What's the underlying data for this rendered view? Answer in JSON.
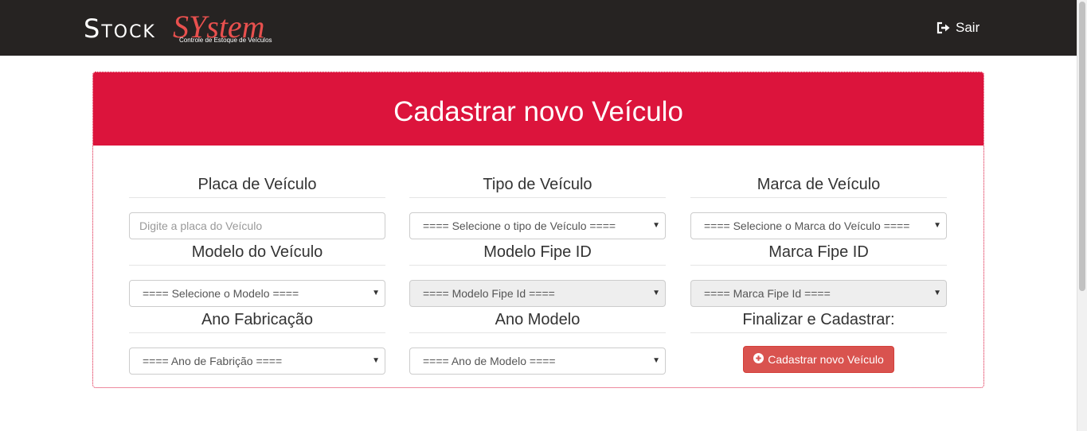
{
  "navbar": {
    "brand_stock": "Stock",
    "brand_system": "SYstem",
    "brand_subtitle": "Controle de Estoque de Veículos",
    "logout_label": "Sair"
  },
  "panel": {
    "title": "Cadastrar novo Veículo"
  },
  "form": {
    "placa": {
      "label": "Placa de Veículo",
      "placeholder": "Digite a placa do Veículo"
    },
    "tipo": {
      "label": "Tipo de Veículo",
      "selected": "==== Selecione o tipo de Veículo ===="
    },
    "marca": {
      "label": "Marca de Veículo",
      "selected": "==== Selecione o Marca do Veículo ===="
    },
    "modelo": {
      "label": "Modelo do Veículo",
      "selected": "==== Selecione o Modelo ===="
    },
    "modelo_fipe": {
      "label": "Modelo Fipe ID",
      "selected": "==== Modelo Fipe Id ===="
    },
    "marca_fipe": {
      "label": "Marca Fipe ID",
      "selected": "==== Marca Fipe Id ===="
    },
    "ano_fabricacao": {
      "label": "Ano Fabricação",
      "selected": "==== Ano de Fabrição ===="
    },
    "ano_modelo": {
      "label": "Ano Modelo",
      "selected": "==== Ano de Modelo ===="
    },
    "finalizar": {
      "label": "Finalizar e Cadastrar:",
      "button_label": "Cadastrar novo Veículo"
    }
  },
  "colors": {
    "navbar_bg": "#262322",
    "panel_accent": "#dc143c",
    "brand_accent": "#e8504e",
    "button_danger": "#d9534f"
  },
  "icons": {
    "logout": "sign-out-icon",
    "caret": "caret-down-icon",
    "add": "plus-circle-icon"
  }
}
